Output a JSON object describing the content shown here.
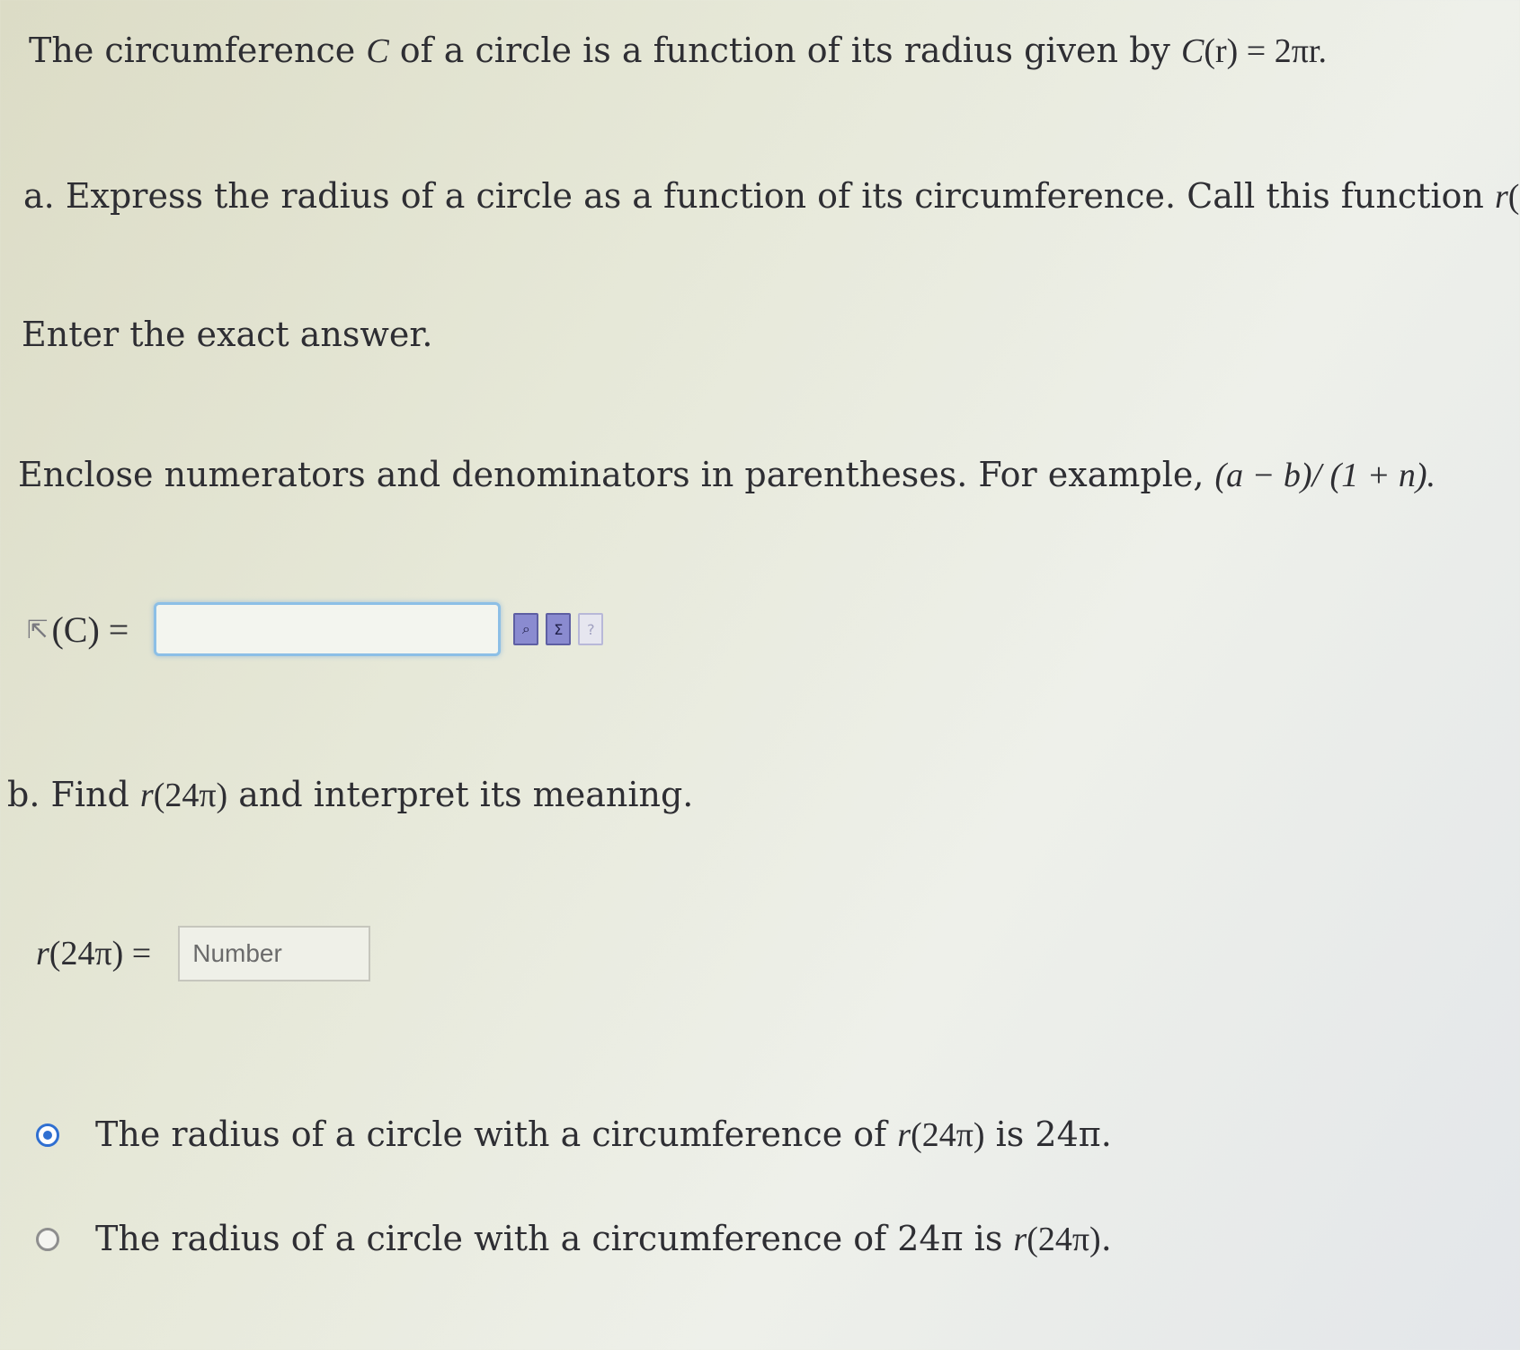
{
  "problem": {
    "intro": {
      "text": "The circumference ",
      "var_c": "C",
      "text2": " of a circle is a function of its radius given by ",
      "formula_lhs": "C",
      "formula_arg": "(r)",
      "formula_eq": " = 2πr."
    },
    "part_a": {
      "prefix": "a.",
      "question": " Express the radius of a circle as a function of its circumference. Call this function ",
      "func": "r",
      "func_arg": "(C)",
      "end": ".",
      "enter_exact": "Enter the exact answer.",
      "enclose_hint": "Enclose numerators and denominators in parentheses. For example, ",
      "example": "(a − b)/ (1 + n).",
      "input_label": "(C) =",
      "input_value": "",
      "tool_icons": [
        "preview-icon",
        "sigma-icon",
        "help-icon"
      ]
    },
    "part_b": {
      "prefix": "b.",
      "question_pre": " Find ",
      "func": "r",
      "func_arg": "(24π)",
      "question_post": " and interpret its meaning.",
      "input_label_func": "r",
      "input_label_arg": "(24π) =",
      "input_placeholder": "Number",
      "options": [
        {
          "selected": true,
          "text_pre": "The radius of a circle with a circumference of ",
          "func": "r",
          "func_arg": "(24π)",
          "text_post": " is 24π."
        },
        {
          "selected": false,
          "text_pre": "The radius of a circle with a circumference of 24π is ",
          "func": "r",
          "func_arg": "(24π)",
          "text_post": "."
        }
      ]
    }
  },
  "colors": {
    "selected_radio": "#2f6fd1",
    "focused_input_border": "#8cbfe6"
  }
}
